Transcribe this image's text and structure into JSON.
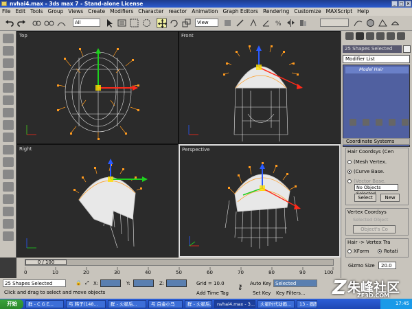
{
  "window": {
    "title": "nvhai4.max - 3ds max 7 - Stand-alone License"
  },
  "menu": [
    "File",
    "Edit",
    "Tools",
    "Group",
    "Views",
    "Create",
    "Modifiers",
    "Character",
    "reactor",
    "Animation",
    "Graph Editors",
    "Rendering",
    "Customize",
    "MAXScript",
    "Help"
  ],
  "toolbar": {
    "selection_filter": "All",
    "ref_coord": "View"
  },
  "viewports": {
    "top": "Top",
    "front": "Front",
    "right": "Right",
    "perspective": "Perspective"
  },
  "timeline": {
    "frame": "0 / 100",
    "ticks": [
      "0",
      "10",
      "20",
      "30",
      "40",
      "50",
      "60",
      "70",
      "80",
      "90",
      "100"
    ]
  },
  "status": {
    "selection": "25 Shapes Selected",
    "prompt": "Click and drag to select and move objects",
    "x_label": "X:",
    "y_label": "Y:",
    "z_label": "Z:",
    "grid": "Grid = 10.0",
    "add_time_tag": "Add Time Tag",
    "auto_key": "Auto Key",
    "key_mode": "Selected",
    "set_key": "Set Key",
    "key_filters": "Key Filters..."
  },
  "command_panel": {
    "name": "25 Shapes Selected",
    "modifier_list": "Modifier List",
    "stack_item": "Model Hair",
    "coord_rollout": "Coordinate Systems",
    "hair_coord_title": "Hair Coordsys (Cen",
    "radio_mesh": "(Mesh Vertex.",
    "radio_curve": "(Curve Base.",
    "radio_vector": "(Vector Base.",
    "no_objects": "No Objects Selected",
    "btn_select": "Select",
    "btn_new": "New",
    "vertex_coord_title": "Vertex Coordsys",
    "selected_object": "Selected Object",
    "objects_coord": "Object's Co",
    "hair_vertex_title": "Hair -> Vertex Tra",
    "radio_xform": "XForm",
    "radio_rotati": "Rotati",
    "gizmo_label": "Gizmo Size",
    "gizmo_value": "20.0"
  },
  "taskbar": {
    "start": "开始",
    "items": [
      "群 - C G E...",
      "与 韩子(148...",
      "群 - 火星后...",
      "与 白金小马",
      "群 - 火星后...",
      "nvhai4.max - 3...",
      "火星时代动画...",
      "13 - 画图"
    ],
    "clock": "17:45"
  },
  "watermark": {
    "text": "朱峰社区",
    "sub": "ZF3D.COM"
  },
  "colors": {
    "hair": "#ff9a1e",
    "mesh": "#e8e8e8",
    "gizmo_x": "#ff2a1a",
    "gizmo_y": "#1ed01e",
    "gizmo_z": "#2a5aff"
  }
}
